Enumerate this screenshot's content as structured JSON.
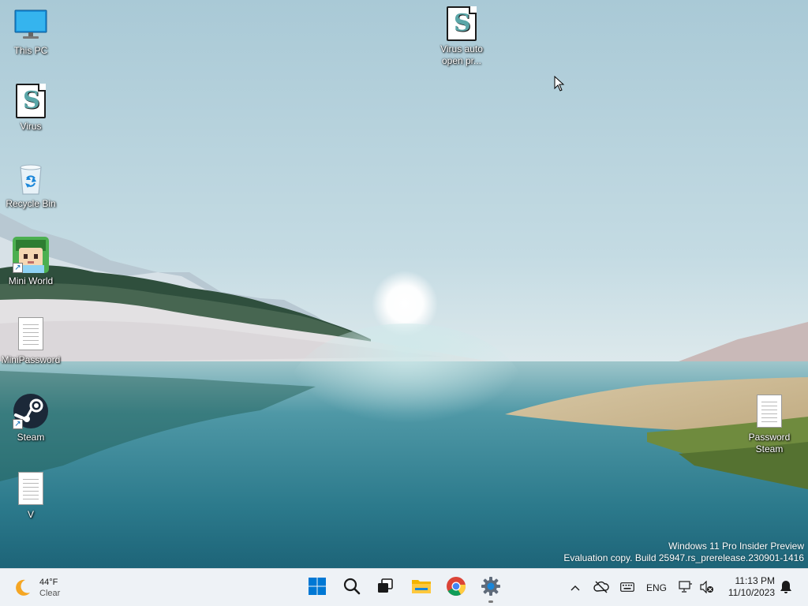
{
  "desktop": {
    "icons": [
      {
        "label": "This PC",
        "icon": "monitor-icon"
      },
      {
        "label": "Virus",
        "icon": "script-file-icon"
      },
      {
        "label": "Recycle Bin",
        "icon": "recycle-bin-icon"
      },
      {
        "label": "Mini World",
        "icon": "mini-world-app-icon"
      },
      {
        "label": "MiniPassword",
        "icon": "text-file-icon"
      },
      {
        "label": "Steam",
        "icon": "steam-icon"
      },
      {
        "label": "V",
        "icon": "text-file-icon"
      },
      {
        "label": "Virus auto open pr...",
        "icon": "script-file-icon"
      },
      {
        "label": "Password Steam",
        "icon": "text-file-icon"
      }
    ]
  },
  "watermark": {
    "line1": "Windows 11 Pro Insider Preview",
    "line2": "Evaluation copy. Build 25947.rs_prerelease.230901-1416"
  },
  "taskbar": {
    "weather": {
      "temp": "44°F",
      "condition": "Clear",
      "icon": "moon-icon"
    },
    "apps": [
      {
        "name": "Start",
        "icon": "windows-logo-icon"
      },
      {
        "name": "Search",
        "icon": "search-icon"
      },
      {
        "name": "Task View",
        "icon": "task-view-icon"
      },
      {
        "name": "File Explorer",
        "icon": "folder-icon"
      },
      {
        "name": "Google Chrome",
        "icon": "chrome-icon"
      },
      {
        "name": "Settings",
        "icon": "gear-icon"
      }
    ],
    "tray": {
      "language": "ENG",
      "time": "11:13 PM",
      "date": "11/10/2023"
    }
  },
  "colors": {
    "taskbar_bg": "#eef2f6",
    "windows_blue": "#0078d4",
    "steam_navy": "#1b2838"
  }
}
